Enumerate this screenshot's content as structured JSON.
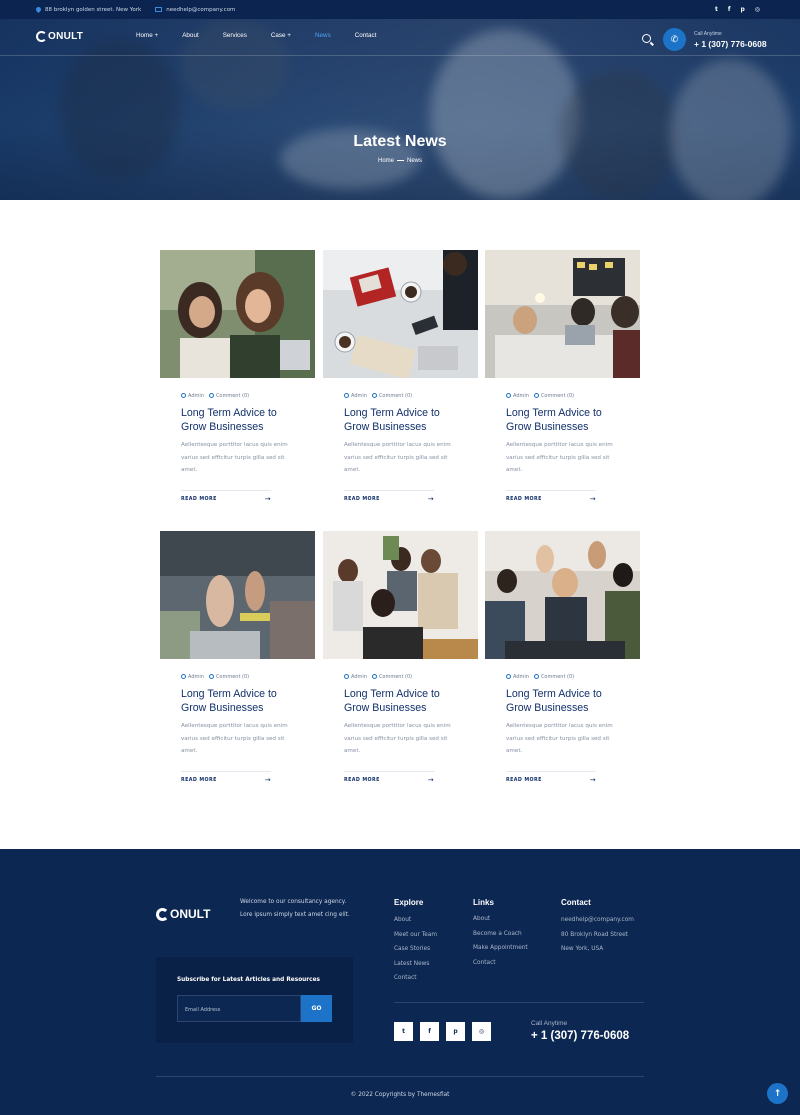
{
  "topbar": {
    "address": "88 broklyn golden street. New York",
    "email": "needhelp@company.com",
    "socials": [
      {
        "icon": "twitter-icon",
        "glyph": "t"
      },
      {
        "icon": "facebook-icon",
        "glyph": "f"
      },
      {
        "icon": "pinterest-icon",
        "glyph": "p"
      },
      {
        "icon": "instagram-icon",
        "glyph": "◎"
      }
    ]
  },
  "header": {
    "logo": "ONULT",
    "menu": [
      "Home +",
      "About",
      "Services",
      "Case +",
      "News",
      "Contact"
    ],
    "active_menu": "News",
    "call_label": "Call Anytime",
    "call_number": "+ 1 (307) 776-0608"
  },
  "hero": {
    "title": "Latest News",
    "breadcrumb_home": "Home",
    "breadcrumb_current": "News"
  },
  "posts": [
    {
      "author": "Admin",
      "comments": "Comment (0)",
      "title": "Long Term Advice to Grow Businesses",
      "excerpt": "Aellentesque porttitor lacus quis enim varius sed efficitur turpis gilla sed sit amet.",
      "read_more": "READ MORE",
      "image": "two-women-laptop-photo"
    },
    {
      "author": "Admin",
      "comments": "Comment (0)",
      "title": "Long Term Advice to Grow Businesses",
      "excerpt": "Aellentesque porttitor lacus quis enim varius sed efficitur turpis gilla sed sit amet.",
      "read_more": "READ MORE",
      "image": "desk-phone-coffee-photo"
    },
    {
      "author": "Admin",
      "comments": "Comment (0)",
      "title": "Long Term Advice to Grow Businesses",
      "excerpt": "Aellentesque porttitor lacus quis enim varius sed efficitur turpis gilla sed sit amet.",
      "read_more": "READ MORE",
      "image": "team-meeting-table-photo"
    },
    {
      "author": "Admin",
      "comments": "Comment (0)",
      "title": "Long Term Advice to Grow Businesses",
      "excerpt": "Aellentesque porttitor lacus quis enim varius sed efficitur turpis gilla sed sit amet.",
      "read_more": "READ MORE",
      "image": "clapping-hands-photo"
    },
    {
      "author": "Admin",
      "comments": "Comment (0)",
      "title": "Long Term Advice to Grow Businesses",
      "excerpt": "Aellentesque porttitor lacus quis enim varius sed efficitur turpis gilla sed sit amet.",
      "read_more": "READ MORE",
      "image": "group-laptop-photo"
    },
    {
      "author": "Admin",
      "comments": "Comment (0)",
      "title": "Long Term Advice to Grow Businesses",
      "excerpt": "Aellentesque porttitor lacus quis enim varius sed efficitur turpis gilla sed sit amet.",
      "read_more": "READ MORE",
      "image": "high-five-team-photo"
    }
  ],
  "footer": {
    "logo": "ONULT",
    "welcome": "Welcome to our consultancy agency. Lore ipsum simply text amet cing elit.",
    "subscribe_title": "Subscribe for Latest Articles and Resources",
    "email_placeholder": "Email Address",
    "go_label": "GO",
    "explore_title": "Explore",
    "explore": [
      "About",
      "Meet our Team",
      "Case Stories",
      "Latest News",
      "Contact"
    ],
    "links_title": "Links",
    "links": [
      "About",
      "Become a Coach",
      "Make Appointment",
      "Contact"
    ],
    "contact_title": "Contact",
    "contact": [
      "needhelp@company.com",
      "80 Broklyn Road Street",
      "New York, USA"
    ],
    "call_label": "Call Anytime",
    "call_number": "+ 1 (307) 776-0608",
    "copyright": "© 2022 Copyrights by Themesflat"
  },
  "colors": {
    "navy": "#0c2752",
    "accent": "#1d73c7",
    "active_link": "#4fa3f2"
  }
}
